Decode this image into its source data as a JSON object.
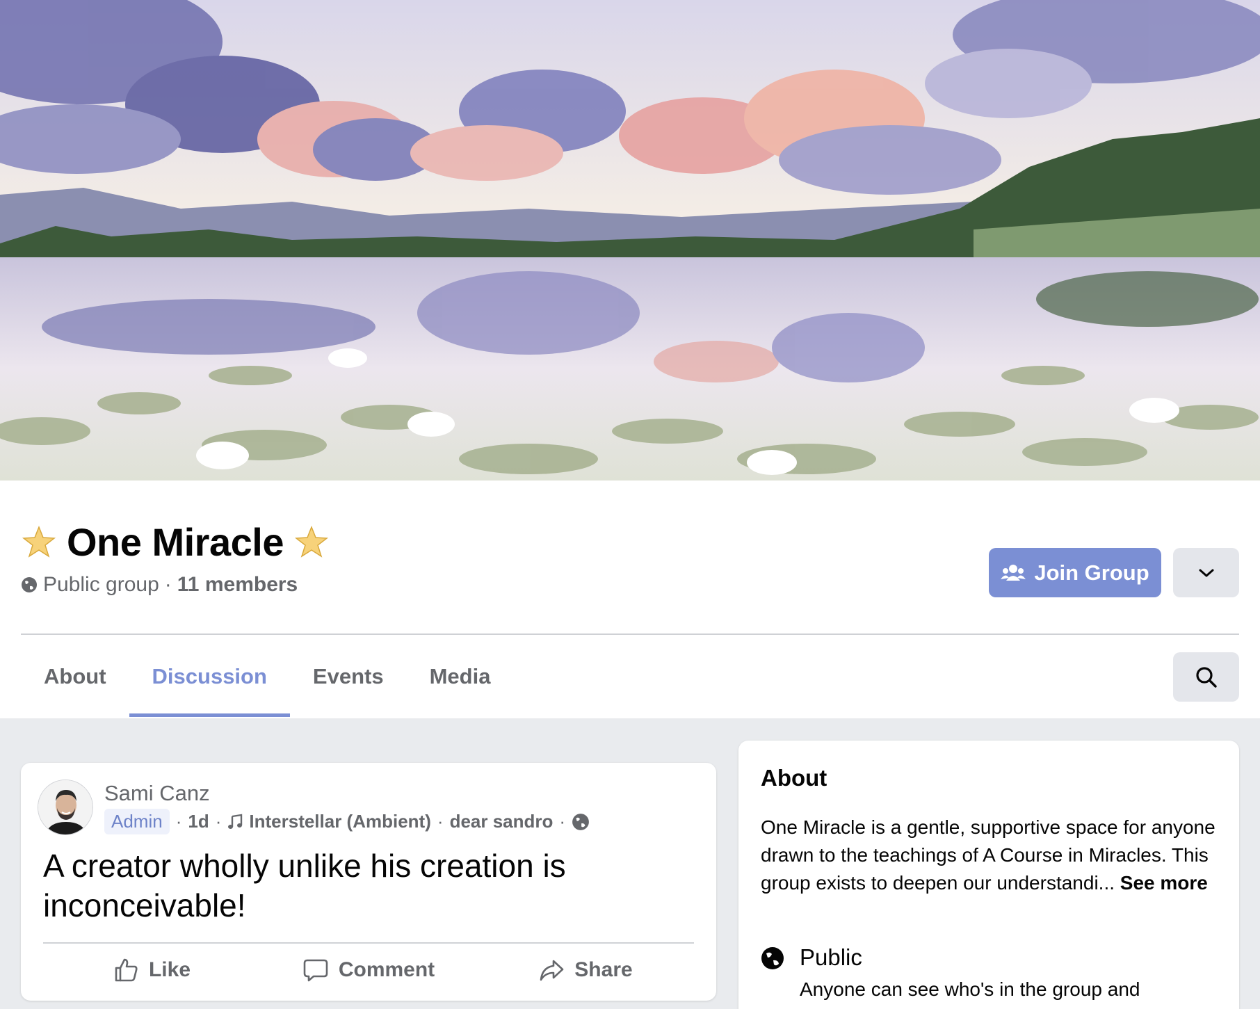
{
  "group": {
    "name": "One Miracle",
    "title_emoji": "🌟",
    "privacy": "Public group",
    "separator": "·",
    "members": "11 members"
  },
  "header_actions": {
    "join_label": "Join Group",
    "accent_color": "#7b8fd4"
  },
  "tabs": [
    {
      "label": "About",
      "active": false
    },
    {
      "label": "Discussion",
      "active": true
    },
    {
      "label": "Events",
      "active": false
    },
    {
      "label": "Media",
      "active": false
    }
  ],
  "post": {
    "author": "Sami Canz",
    "role_badge": "Admin",
    "time": "1d",
    "music": "Interstellar (Ambient)",
    "mention": "dear sandro",
    "text": "A creator wholly unlike his creation is inconceivable!",
    "actions": {
      "like": "Like",
      "comment": "Comment",
      "share": "Share"
    }
  },
  "about": {
    "title": "About",
    "description": "One Miracle is a gentle, supportive space for anyone drawn to the teachings of A Course in Miracles. This group exists to deepen our understandi...",
    "see_more": "See more",
    "privacy_title": "Public",
    "privacy_desc": "Anyone can see who's in the group and"
  },
  "icons": [
    "globe-icon",
    "star-emoji-icon",
    "join-group-icon",
    "chevron-down-icon",
    "search-icon",
    "music-note-icon",
    "like-icon",
    "comment-icon",
    "share-icon"
  ]
}
